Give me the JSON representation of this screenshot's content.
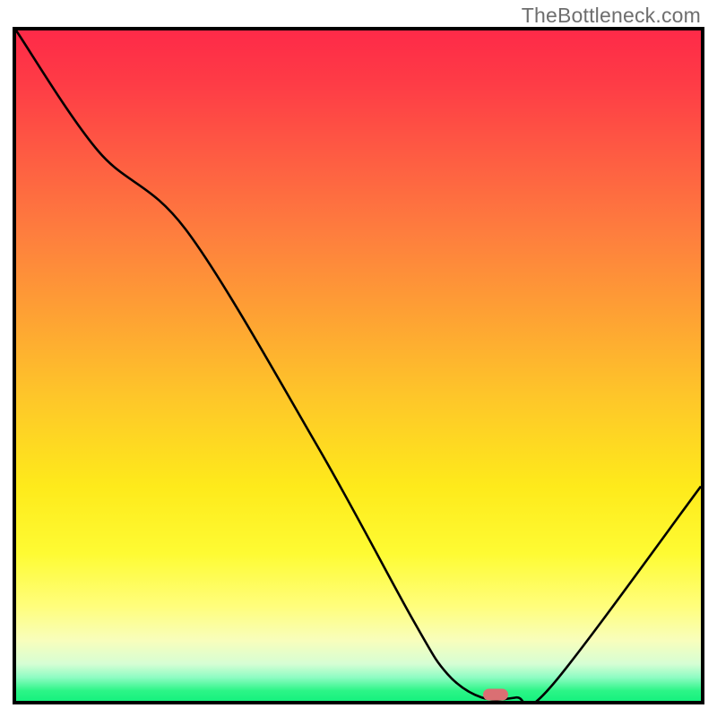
{
  "watermark": "TheBottleneck.com",
  "chart_data": {
    "type": "line",
    "title": "",
    "xlabel": "",
    "ylabel": "",
    "xlim": [
      0,
      100
    ],
    "ylim": [
      0,
      100
    ],
    "x": [
      0,
      12,
      25,
      44,
      58,
      63,
      68,
      73,
      78,
      100
    ],
    "values": [
      100,
      82,
      70,
      38,
      12,
      4,
      0.5,
      0.5,
      2,
      32
    ],
    "marker": {
      "x": 70,
      "y": 1
    },
    "gradient_stops": [
      {
        "pct": 0,
        "color": "#fe2a48"
      },
      {
        "pct": 50,
        "color": "#feb42e"
      },
      {
        "pct": 80,
        "color": "#fefb33"
      },
      {
        "pct": 100,
        "color": "#16f17e"
      }
    ]
  }
}
